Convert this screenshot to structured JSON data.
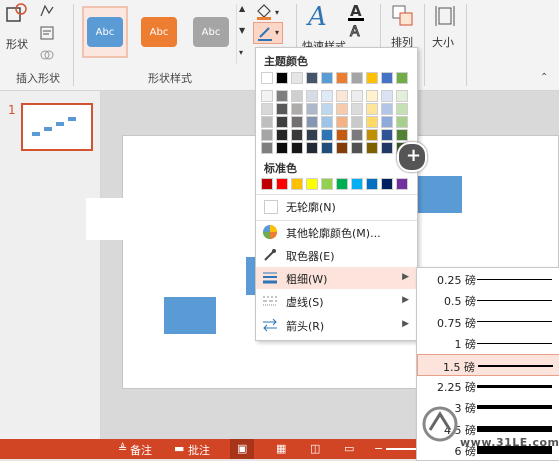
{
  "ribbon": {
    "groups": [
      {
        "label": "插入形状"
      },
      {
        "label": "形状样式"
      },
      {
        "label": "排列"
      },
      {
        "label": "大小"
      }
    ],
    "shape_button_label": "形状",
    "style_gallery": [
      {
        "text": "Abc",
        "color": "#5b9bd5"
      },
      {
        "text": "Abc",
        "color": "#ed7d31"
      },
      {
        "text": "Abc",
        "color": "#a5a5a5"
      }
    ],
    "quick_styles_label": "快速样式",
    "arrange_label": "排列",
    "size_label": "大小"
  },
  "thumbs": {
    "slide_number": "1"
  },
  "menu": {
    "theme_colors_title": "主题颜色",
    "theme_top_row": [
      "#ffffff",
      "#000000",
      "#e7e6e6",
      "#44546a",
      "#5b9bd5",
      "#ed7d31",
      "#a5a5a5",
      "#ffc000",
      "#4472c4",
      "#70ad47"
    ],
    "theme_shades": [
      [
        "#f2f2f2",
        "#7f7f7f",
        "#d0cece",
        "#d6dce4",
        "#deebf6",
        "#fbe5d5",
        "#ededed",
        "#fff2cc",
        "#dae3f3",
        "#e2efd9"
      ],
      [
        "#d8d8d8",
        "#595959",
        "#aeabab",
        "#adb9ca",
        "#bdd7ee",
        "#f7cbac",
        "#dbdbdb",
        "#fee599",
        "#b4c6e7",
        "#c5e0b3"
      ],
      [
        "#bfbfbf",
        "#3f3f3f",
        "#757070",
        "#8496b0",
        "#9dc3e6",
        "#f4b183",
        "#c9c9c9",
        "#ffd965",
        "#8eaadb",
        "#a8d08d"
      ],
      [
        "#a5a5a5",
        "#262626",
        "#3a3838",
        "#323f4f",
        "#2e75b5",
        "#c55a11",
        "#7b7b7b",
        "#bf9000",
        "#2f5496",
        "#538135"
      ],
      [
        "#7f7f7f",
        "#0c0c0c",
        "#171616",
        "#222a35",
        "#1e4e79",
        "#843c0b",
        "#525252",
        "#7f6000",
        "#1f3864",
        "#375623"
      ]
    ],
    "standard_colors_title": "标准色",
    "standard_colors": [
      "#c00000",
      "#ff0000",
      "#ffc000",
      "#ffff00",
      "#92d050",
      "#00b050",
      "#00b0f0",
      "#0070c0",
      "#002060",
      "#7030a0"
    ],
    "items": [
      {
        "label": "无轮廓(N)"
      },
      {
        "label": "其他轮廓颜色(M)..."
      },
      {
        "label": "取色器(E)"
      },
      {
        "label": "粗细(W)"
      },
      {
        "label": "虚线(S)"
      },
      {
        "label": "箭头(R)"
      }
    ]
  },
  "weights": [
    {
      "label": "0.25 磅",
      "pt": 0.25
    },
    {
      "label": "0.5 磅",
      "pt": 0.5
    },
    {
      "label": "0.75 磅",
      "pt": 0.75
    },
    {
      "label": "1 磅",
      "pt": 1
    },
    {
      "label": "1.5 磅",
      "pt": 1.5
    },
    {
      "label": "2.25 磅",
      "pt": 2.25
    },
    {
      "label": "3 磅",
      "pt": 3
    },
    {
      "label": "4.5 磅",
      "pt": 4.5
    },
    {
      "label": "6 磅",
      "pt": 6
    }
  ],
  "status": {
    "notes_label": "备注",
    "comments_label": "批注"
  },
  "watermark": {
    "text": "www.31LE.com"
  },
  "colors": {
    "accent": "#d14424",
    "shape_fill": "#5b9bd5",
    "highlight": "#fce4dc"
  }
}
